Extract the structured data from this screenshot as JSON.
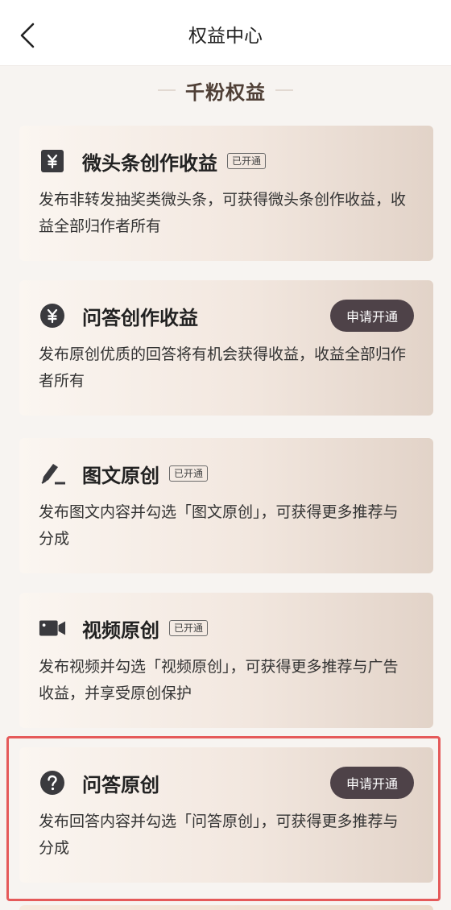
{
  "nav": {
    "title": "权益中心"
  },
  "section": {
    "heading": "千粉权益"
  },
  "cards": [
    {
      "icon": "yuan-square-icon",
      "title": "微头条创作收益",
      "status": "已开通",
      "action": "",
      "description": "发布非转发抽奖类微头条，可获得微头条创作收益，收益全部归作者所有"
    },
    {
      "icon": "yuan-circle-icon",
      "title": "问答创作收益",
      "status": "",
      "action": "申请开通",
      "description": "发布原创优质的回答将有机会获得收益，收益全部归作者所有"
    },
    {
      "icon": "pen-icon",
      "title": "图文原创",
      "status": "已开通",
      "action": "",
      "description": "发布图文内容并勾选「图文原创」，可获得更多推荐与分成"
    },
    {
      "icon": "video-camera-icon",
      "title": "视频原创",
      "status": "已开通",
      "action": "",
      "description": "发布视频并勾选「视频原创」，可获得更多推荐与广告收益，并享受原创保护"
    },
    {
      "icon": "question-circle-icon",
      "title": "问答原创",
      "status": "",
      "action": "申请开通",
      "description": "发布回答内容并勾选「问答原创」，可获得更多推荐与分成"
    }
  ],
  "colors": {
    "background": "#f7f4f1",
    "heading": "#4f3f36",
    "button": "#4e4248",
    "highlight": "#e55a5a"
  }
}
